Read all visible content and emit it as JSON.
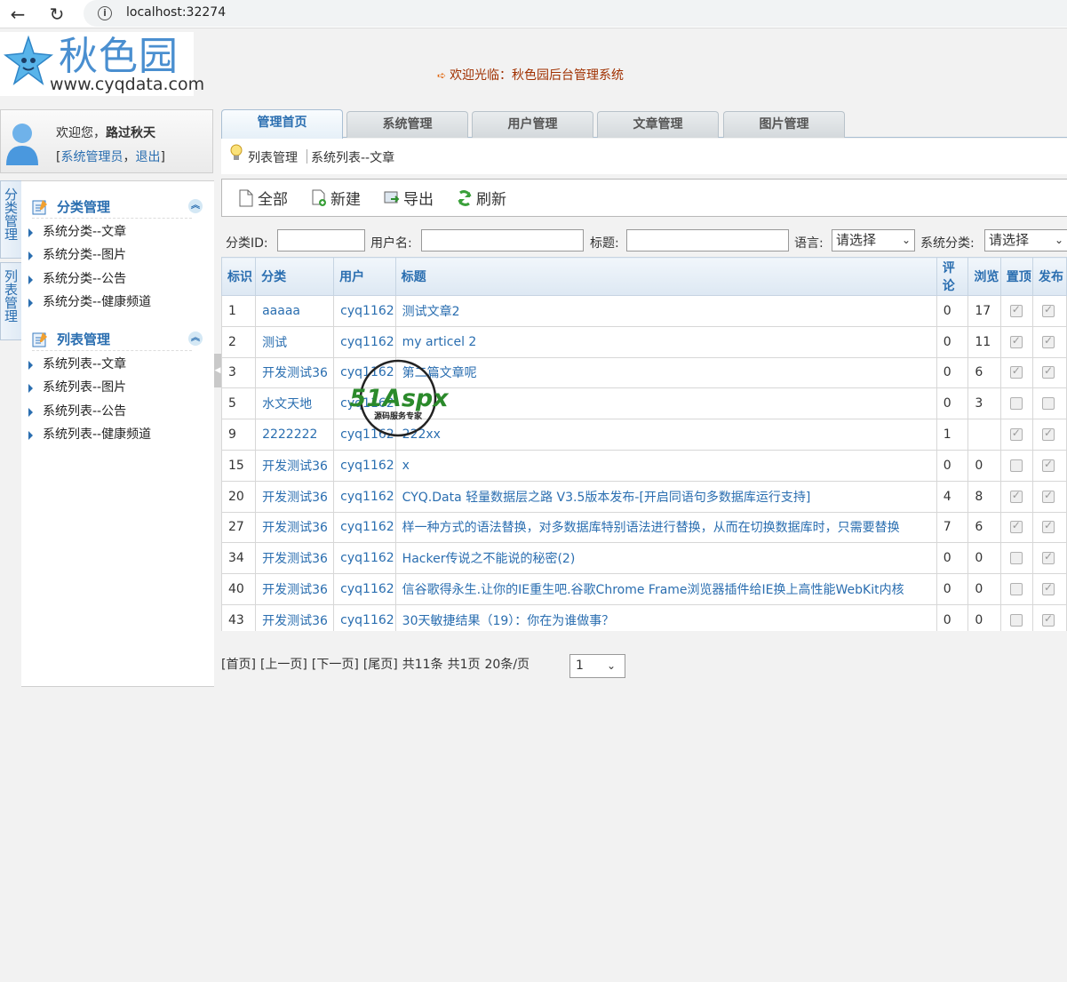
{
  "browser": {
    "url": "localhost:32274"
  },
  "header": {
    "logo_cn": "秋色园",
    "logo_url": "www.cyqdata.com",
    "welcome": "欢迎光临：秋色园后台管理系统"
  },
  "user": {
    "welcome_prefix": "欢迎您，",
    "name": "路过秋天",
    "bracket_open": "[",
    "role": "系统管理员",
    "comma": "，",
    "logout": "退出",
    "bracket_close": "]"
  },
  "vtabs": [
    {
      "label": [
        "分",
        "类",
        "管",
        "理"
      ]
    },
    {
      "label": [
        "列",
        "表",
        "管",
        "理"
      ]
    }
  ],
  "menu": {
    "groups": [
      {
        "title": "分类管理",
        "items": [
          "系统分类--文章",
          "系统分类--图片",
          "系统分类--公告",
          "系统分类--健康频道"
        ]
      },
      {
        "title": "列表管理",
        "items": [
          "系统列表--文章",
          "系统列表--图片",
          "系统列表--公告",
          "系统列表--健康频道"
        ]
      }
    ]
  },
  "tabs": [
    "管理首页",
    "系统管理",
    "用户管理",
    "文章管理",
    "图片管理"
  ],
  "breadcrumb": {
    "first": "列表管理",
    "second": "系统列表--文章"
  },
  "toolbar": {
    "all": "全部",
    "new": "新建",
    "export": "导出",
    "refresh": "刷新"
  },
  "filters": {
    "category_id": "分类ID:",
    "username": "用户名:",
    "title": "标题:",
    "language": "语言:",
    "language_value": "请选择",
    "sys_category": "系统分类:",
    "sys_category_value": "请选择"
  },
  "table": {
    "headers": [
      "标识",
      "分类",
      "用户",
      "标题",
      "评论",
      "浏览",
      "置顶",
      "发布"
    ],
    "rows": [
      {
        "id": "1",
        "cat": "aaaaa",
        "user": "cyq1162",
        "title": "测试文章2",
        "comments": "0",
        "views": "17",
        "top": true,
        "pub": true
      },
      {
        "id": "2",
        "cat": "测试",
        "user": "cyq1162",
        "title": "my articel 2",
        "comments": "0",
        "views": "11",
        "top": true,
        "pub": true
      },
      {
        "id": "3",
        "cat": "开发测试36",
        "user": "cyq1162",
        "title": "第二篇文章呢",
        "comments": "0",
        "views": "6",
        "top": true,
        "pub": true
      },
      {
        "id": "5",
        "cat": "水文天地",
        "user": "cyq1162",
        "title": "",
        "comments": "0",
        "views": "3",
        "top": false,
        "pub": false
      },
      {
        "id": "9",
        "cat": "2222222",
        "user": "cyq1162",
        "title": "222xx",
        "comments": "1",
        "views": "",
        "top": true,
        "pub": true
      },
      {
        "id": "15",
        "cat": "开发测试36",
        "user": "cyq1162",
        "title": "x",
        "comments": "0",
        "views": "0",
        "top": false,
        "pub": true
      },
      {
        "id": "20",
        "cat": "开发测试36",
        "user": "cyq1162",
        "title": "CYQ.Data 轻量数据层之路 V3.5版本发布-[开启同语句多数据库运行支持]",
        "comments": "4",
        "views": "8",
        "top": true,
        "pub": true
      },
      {
        "id": "27",
        "cat": "开发测试36",
        "user": "cyq1162",
        "title": "样一种方式的语法替换，对多数据库特别语法进行替换，从而在切换数据库时，只需要替换",
        "comments": "7",
        "views": "6",
        "top": true,
        "pub": true
      },
      {
        "id": "34",
        "cat": "开发测试36",
        "user": "cyq1162",
        "title": "Hacker传说之不能说的秘密(2)",
        "comments": "0",
        "views": "0",
        "top": false,
        "pub": true
      },
      {
        "id": "40",
        "cat": "开发测试36",
        "user": "cyq1162",
        "title": "信谷歌得永生.让你的IE重生吧.谷歌Chrome Frame浏览器插件给IE换上高性能WebKit内核",
        "comments": "0",
        "views": "0",
        "top": false,
        "pub": true
      },
      {
        "id": "43",
        "cat": "开发测试36",
        "user": "cyq1162",
        "title": "30天敏捷结果（19）：你在为谁做事？",
        "comments": "0",
        "views": "0",
        "top": false,
        "pub": true
      }
    ]
  },
  "pager": {
    "first": "[首页]",
    "prev": "[上一页]",
    "next": "[下一页]",
    "last": "[尾页]",
    "total": "共11条",
    "pages": "共1页",
    "per_page": "20条/页",
    "page_value": "1"
  },
  "watermark": {
    "brand": "51Aspx",
    "slogan": "源码服务专家"
  }
}
